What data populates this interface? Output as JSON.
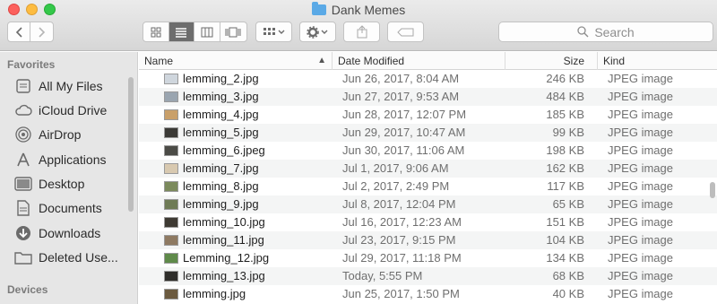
{
  "window": {
    "title": "Dank Memes"
  },
  "toolbar": {
    "search_placeholder": "Search"
  },
  "sidebar": {
    "favorites_heading": "Favorites",
    "devices_heading": "Devices",
    "items": [
      {
        "label": "All My Files",
        "icon": "all-files-icon"
      },
      {
        "label": "iCloud Drive",
        "icon": "cloud-icon"
      },
      {
        "label": "AirDrop",
        "icon": "airdrop-icon"
      },
      {
        "label": "Applications",
        "icon": "applications-icon"
      },
      {
        "label": "Desktop",
        "icon": "desktop-icon"
      },
      {
        "label": "Documents",
        "icon": "documents-icon"
      },
      {
        "label": "Downloads",
        "icon": "downloads-icon"
      },
      {
        "label": "Deleted Use...",
        "icon": "folder-icon"
      }
    ]
  },
  "columns": {
    "name": "Name",
    "date": "Date Modified",
    "size": "Size",
    "kind": "Kind"
  },
  "files": [
    {
      "name": "lemming_2.jpg",
      "date": "Jun 26, 2017, 8:04 AM",
      "size": "246 KB",
      "kind": "JPEG image",
      "thumb": "#cfd6dd"
    },
    {
      "name": "lemming_3.jpg",
      "date": "Jun 27, 2017, 9:53 AM",
      "size": "484 KB",
      "kind": "JPEG image",
      "thumb": "#9aa5b0"
    },
    {
      "name": "lemming_4.jpg",
      "date": "Jun 28, 2017, 12:07 PM",
      "size": "185 KB",
      "kind": "JPEG image",
      "thumb": "#c9a06a"
    },
    {
      "name": "lemming_5.jpg",
      "date": "Jun 29, 2017, 10:47 AM",
      "size": "99 KB",
      "kind": "JPEG image",
      "thumb": "#3b3a36"
    },
    {
      "name": "lemming_6.jpeg",
      "date": "Jun 30, 2017, 11:06 AM",
      "size": "198 KB",
      "kind": "JPEG image",
      "thumb": "#4b4b46"
    },
    {
      "name": "lemming_7.jpg",
      "date": "Jul 1, 2017, 9:06 AM",
      "size": "162 KB",
      "kind": "JPEG image",
      "thumb": "#d8c9b0"
    },
    {
      "name": "lemming_8.jpg",
      "date": "Jul 2, 2017, 2:49 PM",
      "size": "117 KB",
      "kind": "JPEG image",
      "thumb": "#7b8a5c"
    },
    {
      "name": "lemming_9.jpg",
      "date": "Jul 8, 2017, 12:04 PM",
      "size": "65 KB",
      "kind": "JPEG image",
      "thumb": "#6e7b55"
    },
    {
      "name": "lemming_10.jpg",
      "date": "Jul 16, 2017, 12:23 AM",
      "size": "151 KB",
      "kind": "JPEG image",
      "thumb": "#3e3a33"
    },
    {
      "name": "lemming_11.jpg",
      "date": "Jul 23, 2017, 9:15 PM",
      "size": "104 KB",
      "kind": "JPEG image",
      "thumb": "#8e7a62"
    },
    {
      "name": "Lemming_12.jpg",
      "date": "Jul 29, 2017, 11:18 PM",
      "size": "134 KB",
      "kind": "JPEG image",
      "thumb": "#5f8a4a"
    },
    {
      "name": "lemming_13.jpg",
      "date": "Today, 5:55 PM",
      "size": "68 KB",
      "kind": "JPEG image",
      "thumb": "#2e2d2a"
    },
    {
      "name": "lemming.jpg",
      "date": "Jun 25, 2017, 1:50 PM",
      "size": "40 KB",
      "kind": "JPEG image",
      "thumb": "#6b5a3f"
    }
  ]
}
